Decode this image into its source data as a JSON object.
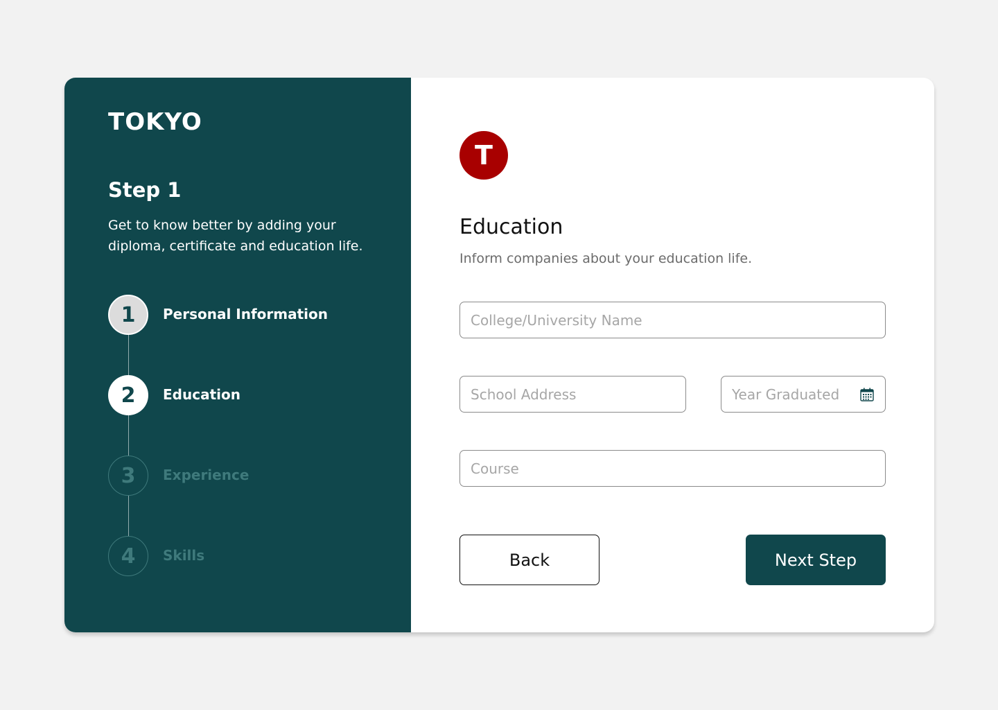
{
  "brand": {
    "logo_text": "TOKYO",
    "badge_letter": "T",
    "badge_color": "#a80000"
  },
  "sidebar": {
    "step_title": "Step 1",
    "step_description": "Get to know better by adding your diploma, certificate and education life.",
    "steps": [
      {
        "number": "1",
        "label": "Personal Information",
        "state": "completed"
      },
      {
        "number": "2",
        "label": "Education",
        "state": "active"
      },
      {
        "number": "3",
        "label": "Experience",
        "state": "pending"
      },
      {
        "number": "4",
        "label": "Skills",
        "state": "pending"
      }
    ]
  },
  "form": {
    "title": "Education",
    "subtitle": "Inform companies about your education life.",
    "fields": {
      "college": {
        "placeholder": "College/University Name",
        "value": ""
      },
      "school_address": {
        "placeholder": "School Address",
        "value": ""
      },
      "year_graduated": {
        "placeholder": "Year Graduated",
        "value": "",
        "icon": "calendar-icon"
      },
      "course": {
        "placeholder": "Course",
        "value": ""
      }
    },
    "back_label": "Back",
    "next_label": "Next Step"
  },
  "colors": {
    "primary": "#10474c",
    "background": "#f2f2f2",
    "accent_red": "#a80000"
  }
}
